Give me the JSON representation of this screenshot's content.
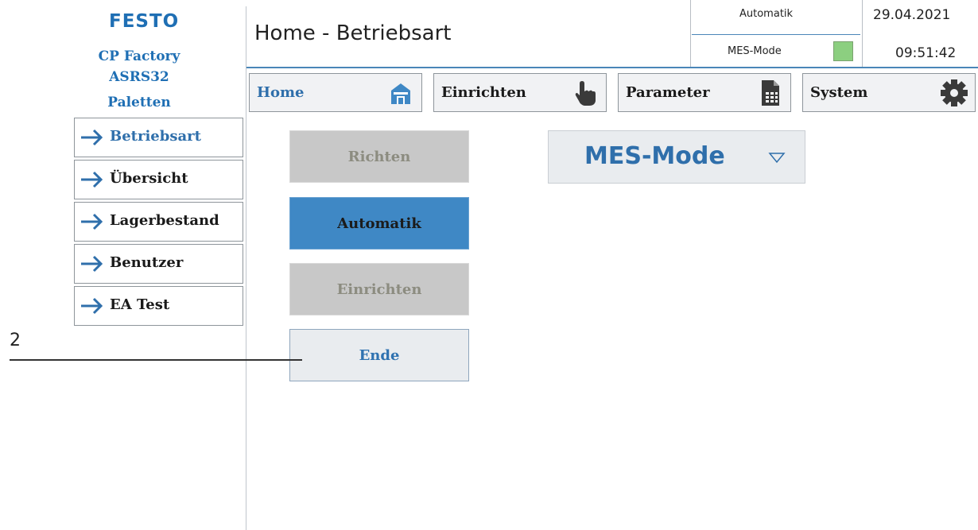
{
  "brand": {
    "logo": "FESTO",
    "line1": "CP Factory",
    "line2": "ASRS32",
    "line3": "Paletten"
  },
  "header": {
    "title": "Home - Betriebsart",
    "mode": "Automatik",
    "mes_mode_label": "MES-Mode",
    "mes_indicator_color": "#8ccf80",
    "date": "29.04.2021",
    "time": "09:51:42"
  },
  "nav": {
    "tabs": [
      {
        "label": "Home",
        "icon": "home-icon",
        "active": true
      },
      {
        "label": "Einrichten",
        "icon": "hand-pointer-icon",
        "active": false
      },
      {
        "label": "Parameter",
        "icon": "document-icon",
        "active": false
      },
      {
        "label": "System",
        "icon": "gear-icon",
        "active": false
      }
    ]
  },
  "sidebar": {
    "items": [
      {
        "label": "Betriebsart",
        "icon": "arrow-right-icon",
        "active": true
      },
      {
        "label": "Übersicht",
        "icon": "arrow-right-icon",
        "active": false
      },
      {
        "label": "Lagerbestand",
        "icon": "arrow-right-icon",
        "active": false
      },
      {
        "label": "Benutzer",
        "icon": "arrow-right-icon",
        "active": false
      },
      {
        "label": "EA Test",
        "icon": "arrow-right-icon",
        "active": false
      }
    ]
  },
  "modes": {
    "buttons": [
      {
        "label": "Richten",
        "state": "disabled"
      },
      {
        "label": "Automatik",
        "state": "active"
      },
      {
        "label": "Einrichten",
        "state": "disabled"
      },
      {
        "label": "Ende",
        "state": "normal"
      }
    ]
  },
  "mes_select": {
    "value": "MES-Mode",
    "icon": "chevron-down-icon"
  },
  "callout": {
    "number": "2"
  },
  "colors": {
    "accent": "#2f6fab",
    "active_button": "#3f88c5",
    "disabled_button": "#c8c8c8"
  }
}
